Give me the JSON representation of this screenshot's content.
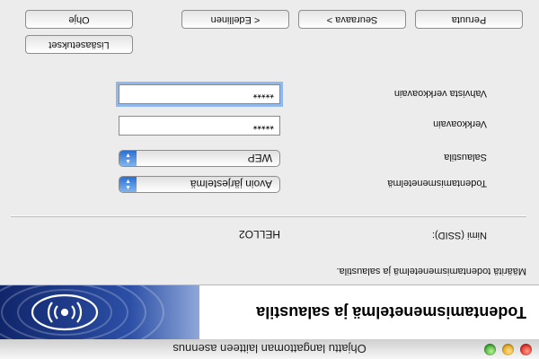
{
  "window": {
    "title": "Ohjattu langattoman laitteen asennus"
  },
  "banner": {
    "title": "Todentamismenetelmä ja salaustila",
    "logo_icon": "wireless-signal-icon",
    "accent_color": "#1c3d8f"
  },
  "instructions": "Määritä todentamismenetelmä ja salaustila.",
  "form": {
    "ssid_label": "Nimi (SSID):",
    "ssid_value": "HELLO2",
    "auth_label": "Todentamismenetelmä",
    "auth_value": "Avoin järjestelmä",
    "encryption_label": "Salaustila",
    "encryption_value": "WEP",
    "key_label": "Verkkoavain",
    "key_value": "*****",
    "confirm_label": "Vahvista verkkoavain",
    "confirm_value": "*****"
  },
  "buttons": {
    "advanced": "Lisäasetukset",
    "help": "Ohje",
    "back": "< Edellinen",
    "next": "Seuraava >",
    "cancel": "Peruuta"
  }
}
